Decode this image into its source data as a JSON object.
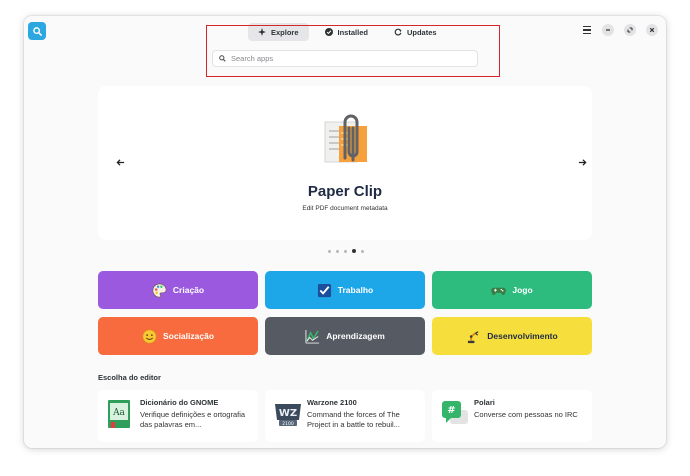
{
  "header": {
    "tabs": [
      {
        "label": "Explore",
        "icon": "compass-icon",
        "active": true
      },
      {
        "label": "Installed",
        "icon": "check-circle-icon",
        "active": false
      },
      {
        "label": "Updates",
        "icon": "refresh-icon",
        "active": false
      }
    ],
    "search_placeholder": "Search apps"
  },
  "featured": {
    "name": "Paper Clip",
    "description": "Edit PDF document metadata",
    "icon": "paperclip-document-icon",
    "page_count": 5,
    "active_page": 4
  },
  "categories": [
    {
      "label": "Criação",
      "icon": "palette-icon",
      "bg": "#9b59e0",
      "fg": "#ffffff"
    },
    {
      "label": "Trabalho",
      "icon": "checkbox-icon",
      "bg": "#1ea7e8",
      "fg": "#ffffff"
    },
    {
      "label": "Jogo",
      "icon": "gamepad-icon",
      "bg": "#2dbb7e",
      "fg": "#ffffff"
    },
    {
      "label": "Socialização",
      "icon": "smiley-icon",
      "bg": "#f86b3e",
      "fg": "#ffffff"
    },
    {
      "label": "Aprendizagem",
      "icon": "graph-icon",
      "bg": "#555a63",
      "fg": "#ffffff"
    },
    {
      "label": "Desenvolvimento",
      "icon": "robot-arm-icon",
      "bg": "#f6df3c",
      "fg": "#1f2a44"
    }
  ],
  "editors_choice": {
    "title": "Escolha do editor",
    "apps": [
      {
        "name": "Dicionário do GNOME",
        "summary": "Verifique definições e ortografia das palavras em...",
        "icon": "dictionary-icon"
      },
      {
        "name": "Warzone 2100",
        "summary": "Command the forces of The Project in a battle to rebuil...",
        "icon": "warzone-icon"
      },
      {
        "name": "Polari",
        "summary": "Converse com pessoas no IRC",
        "icon": "chat-bubble-icon"
      }
    ]
  },
  "colors": {
    "accent": "#2da7e0",
    "highlight_border": "#d6262a"
  }
}
